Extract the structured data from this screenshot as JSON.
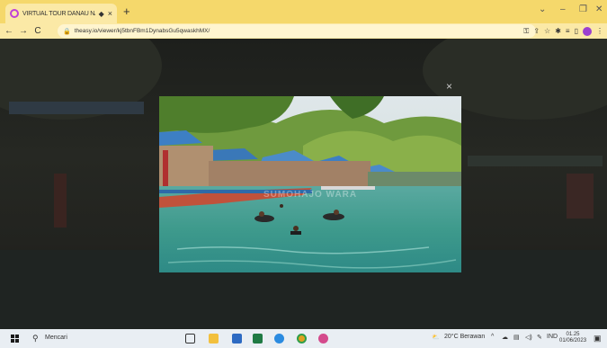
{
  "browser": {
    "tab": {
      "title": "VIRTUAL TOUR DANAU NA",
      "audio_icon": "speaker-icon",
      "close_label": "×"
    },
    "new_tab_label": "+",
    "window_controls": {
      "dropdown": "⌄",
      "minimize": "–",
      "restore": "❐",
      "close": "✕"
    },
    "nav": {
      "back": "←",
      "forward": "→",
      "reload": "C"
    },
    "address_bar": {
      "url": "theasy.io/viewer/kj5tbnFBm1DynabsGu5qwaskhMX/"
    },
    "colors": {
      "tabstrip": "#f5d86b",
      "toolbar": "#fbe9a6",
      "profile": "#9b40d0"
    }
  },
  "viewer": {
    "close_label": "×",
    "photo": {
      "watermark": "SUMOHAJO WARA",
      "description_icon": "lake-photo"
    }
  },
  "taskbar": {
    "search_placeholder": "Mencari",
    "weather": "20°C Berawan",
    "tray_language": "IND",
    "time": "01.25",
    "date": "01/06/2023"
  }
}
